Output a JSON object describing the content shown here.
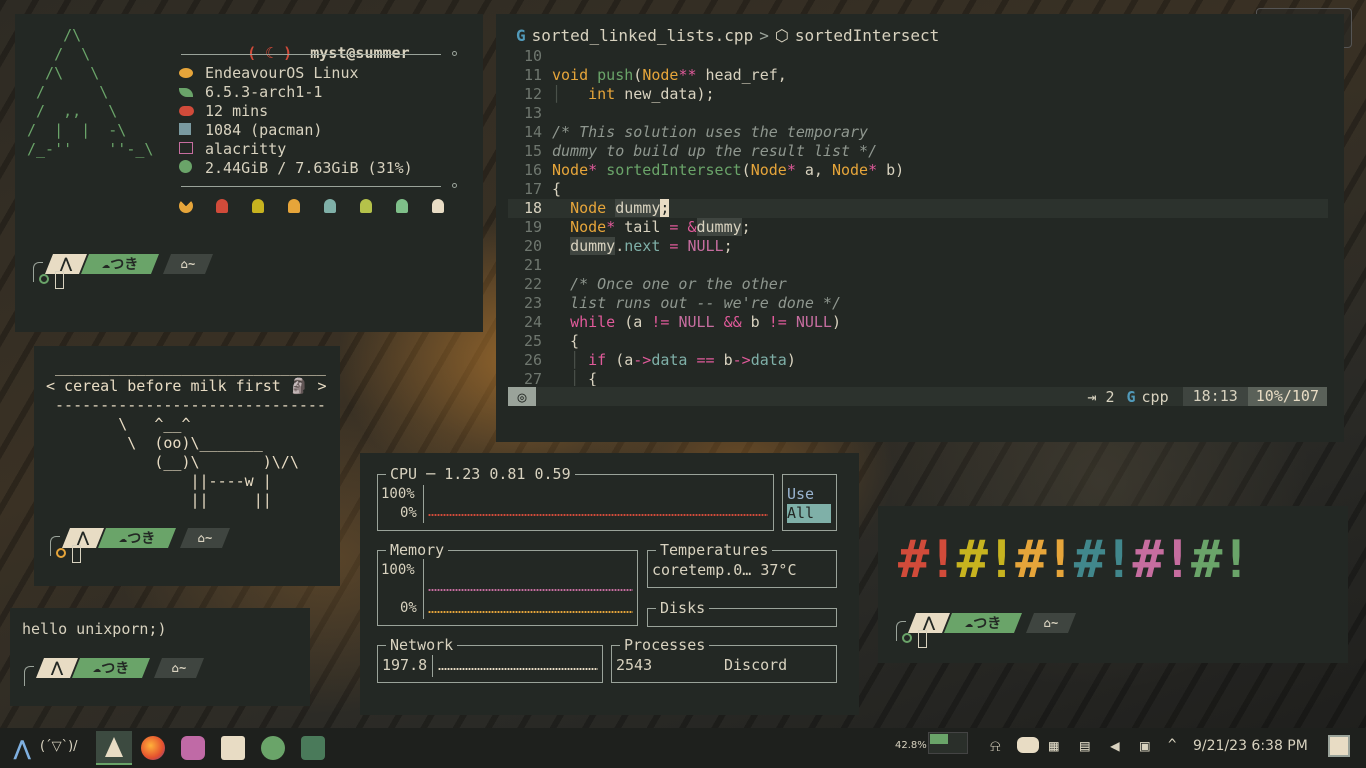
{
  "colors": {
    "bg": "#232824",
    "green": "#6aa469",
    "cream": "#e8dcc4",
    "red": "#d14b3a",
    "orange": "#e69a3a",
    "yellow": "#c7b31f",
    "teal": "#41878c",
    "pink": "#c66d9f"
  },
  "prompt": {
    "folder": "つき",
    "home": "~"
  },
  "fetch": {
    "title_icon": "( ☾ )",
    "user": "myst@summer",
    "logo": [
      "    /\\",
      "   /  \\",
      "  /\\   \\",
      " /      \\",
      " /  ,,   \\",
      "/  |  |  -\\",
      "/_-''    ''-_\\"
    ],
    "rows": [
      {
        "icon": "planet-icon",
        "text": "EndeavourOS Linux"
      },
      {
        "icon": "leaf-icon",
        "text": "6.5.3-arch1-1"
      },
      {
        "icon": "cloud-icon",
        "text": "12 mins"
      },
      {
        "icon": "package-icon",
        "text": "1084 (pacman)"
      },
      {
        "icon": "terminal-icon",
        "text": "alacritty"
      },
      {
        "icon": "check-icon",
        "text": "2.44GiB / 7.63GiB (31%)"
      }
    ]
  },
  "cowsay": {
    "lines": [
      " ______________________________",
      "< cereal before milk first 🗿 >",
      " ------------------------------",
      "        \\   ^__^",
      "         \\  (oo)\\_______",
      "            (__)\\       )\\/\\",
      "                ||----w |",
      "                ||     ||"
    ]
  },
  "hello": {
    "text": "hello unixporn;)"
  },
  "editor": {
    "file": "sorted_linked_lists.cpp",
    "sep": ">",
    "symbol": "sortedIntersect",
    "indent": "⇥ 2",
    "lang": "cpp",
    "pos": "18:13",
    "progress": "10%/107"
  },
  "btop": {
    "cpu": {
      "title": "CPU",
      "load": "1.23 0.81 0.59",
      "max": "100%",
      "min": "0%",
      "opt1": "Use",
      "opt2": "All"
    },
    "mem": {
      "title": "Memory",
      "max": "100%",
      "min": "0%"
    },
    "temps": {
      "title": "Temperatures",
      "row": "coretemp.0… 37°C"
    },
    "disks": {
      "title": "Disks"
    },
    "net": {
      "title": "Network",
      "value": "197.8"
    },
    "proc": {
      "title": "Processes",
      "pid": "2543",
      "name": "Discord"
    }
  },
  "taskbar": {
    "kaomoji": "(´▽`)/",
    "zoom": "42.8%",
    "datetime": "9/21/23 6:38 PM"
  }
}
